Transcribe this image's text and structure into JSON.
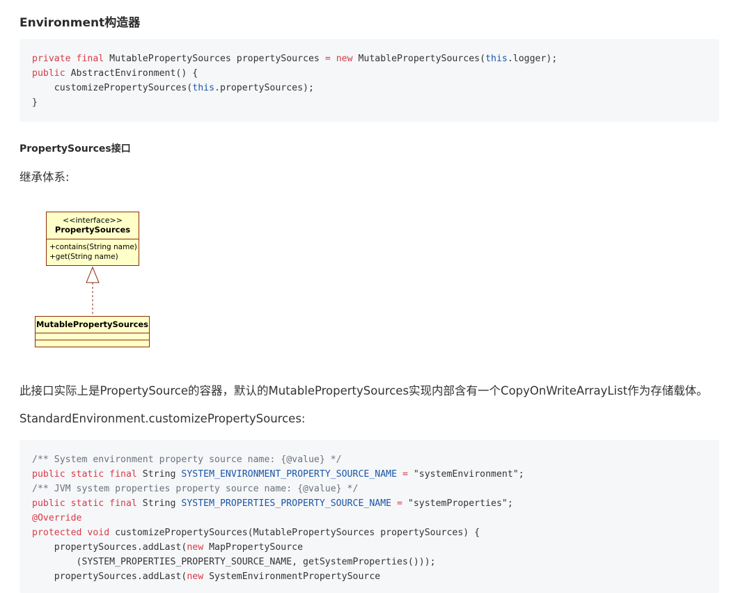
{
  "headings": {
    "environment_constructor": "Environment构造器",
    "property_sources_interface": "PropertySources接口"
  },
  "paragraphs": {
    "inheritance": "继承体系:",
    "description": "此接口实际上是PropertySource的容器，默认的MutablePropertySources实现内部含有一个CopyOnWriteArrayList作为存储载体。",
    "standard_env": "StandardEnvironment.customizePropertySources:"
  },
  "code_block_1": {
    "lines": [
      [
        {
          "t": "kw",
          "v": "private final "
        },
        {
          "t": "ty",
          "v": "MutablePropertySources propertySources "
        },
        {
          "t": "kw",
          "v": "= new "
        },
        {
          "t": "ty",
          "v": "MutablePropertySources("
        },
        {
          "t": "th",
          "v": "this"
        },
        {
          "t": "ty",
          "v": ".logger);"
        }
      ],
      [
        {
          "t": "kw",
          "v": "public "
        },
        {
          "t": "ty",
          "v": "AbstractEnvironment() {"
        }
      ],
      [
        {
          "t": "ty",
          "v": "    customizePropertySources("
        },
        {
          "t": "th",
          "v": "this"
        },
        {
          "t": "ty",
          "v": ".propertySources);"
        }
      ],
      [
        {
          "t": "ty",
          "v": "}"
        }
      ]
    ]
  },
  "code_block_2": {
    "lines": [
      [
        {
          "t": "cm",
          "v": "/** System environment property source name: {@value} */"
        }
      ],
      [
        {
          "t": "kw",
          "v": "public static final "
        },
        {
          "t": "ty",
          "v": "String "
        },
        {
          "t": "cn",
          "v": "SYSTEM_ENVIRONMENT_PROPERTY_SOURCE_NAME"
        },
        {
          "t": "kw",
          "v": " = "
        },
        {
          "t": "st",
          "v": "\"systemEnvironment\""
        },
        {
          "t": "ty",
          "v": ";"
        }
      ],
      [
        {
          "t": "cm",
          "v": "/** JVM system properties property source name: {@value} */"
        }
      ],
      [
        {
          "t": "kw",
          "v": "public static final "
        },
        {
          "t": "ty",
          "v": "String "
        },
        {
          "t": "cn",
          "v": "SYSTEM_PROPERTIES_PROPERTY_SOURCE_NAME"
        },
        {
          "t": "kw",
          "v": " = "
        },
        {
          "t": "st",
          "v": "\"systemProperties\""
        },
        {
          "t": "ty",
          "v": ";"
        }
      ],
      [
        {
          "t": "an",
          "v": "@Override"
        }
      ],
      [
        {
          "t": "kw",
          "v": "protected void "
        },
        {
          "t": "ty",
          "v": "customizePropertySources(MutablePropertySources propertySources) {"
        }
      ],
      [
        {
          "t": "ty",
          "v": "    propertySources.addLast("
        },
        {
          "t": "kw",
          "v": "new "
        },
        {
          "t": "ty",
          "v": "MapPropertySource"
        }
      ],
      [
        {
          "t": "ty",
          "v": "        (SYSTEM_PROPERTIES_PROPERTY_SOURCE_NAME, getSystemProperties()));"
        }
      ],
      [
        {
          "t": "ty",
          "v": "    propertySources.addLast("
        },
        {
          "t": "kw",
          "v": "new "
        },
        {
          "t": "ty",
          "v": "SystemEnvironmentPropertySource"
        }
      ]
    ]
  },
  "uml": {
    "interface_stereotype": "<<interface>>",
    "interface_name": "PropertySources",
    "methods": [
      "+contains(String name)",
      "+get(String name)"
    ],
    "impl_name": "MutablePropertySources"
  },
  "colors": {
    "keyword": "#d73a49",
    "this_keyword": "#1a56a8",
    "constant": "#1a56a8",
    "comment": "#6a737d",
    "code_bg": "#f6f7f9",
    "uml_fill": "#ffffc8",
    "uml_border": "#8b2b10"
  }
}
